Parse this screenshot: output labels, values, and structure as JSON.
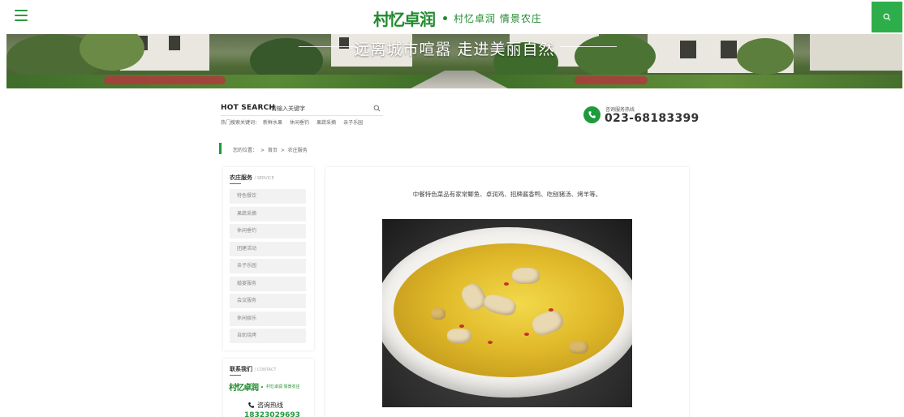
{
  "header": {
    "menu_icon": "hamburger-menu-icon",
    "brand_logo_text": "村忆卓润",
    "brand_tagline": "村忆卓润 情景农庄",
    "search_icon": "search-icon",
    "accent_color": "#2eae4a"
  },
  "banner": {
    "slogan": "远离城市喧嚣 走进美丽自然"
  },
  "search": {
    "title": "HOT SEARCH",
    "placeholder": "请输入关键字",
    "hot_label": "热门搜索关键词：",
    "hot_keywords": [
      "新鲜水果",
      "休闲垂钓",
      "果蔬采摘",
      "亲子乐园"
    ]
  },
  "hotline": {
    "label": "咨询服务热线",
    "number": "023-68183399",
    "icon": "phone-icon"
  },
  "breadcrumb": {
    "prefix": "您的位置：",
    "items": [
      "首页",
      "农庄服务"
    ],
    "separators": [
      ">",
      ">"
    ]
  },
  "sidebar": {
    "title": "农庄服务",
    "subtitle": "/ SERVICE",
    "items": [
      {
        "label": "特色餐饮"
      },
      {
        "label": "果蔬采摘"
      },
      {
        "label": "休闲垂钓"
      },
      {
        "label": "团建活动"
      },
      {
        "label": "亲子乐园"
      },
      {
        "label": "婚宴服务"
      },
      {
        "label": "会议服务"
      },
      {
        "label": "休闲娱乐"
      },
      {
        "label": "自助烧烤"
      }
    ]
  },
  "contact": {
    "title": "联系我们",
    "subtitle": "/ CONTACT",
    "mini_logo": "村忆卓润",
    "mini_tagline": "村忆卓润 情景农庄",
    "phone_label": "咨询热线",
    "phone_number": "18323029693"
  },
  "content": {
    "intro": "中餐特色菜品有家常鲫鱼、卓润鸡、招牌酱香鸭、吃刨猪汤、烤羊等。",
    "image_alt": "chicken-soup-dish"
  }
}
